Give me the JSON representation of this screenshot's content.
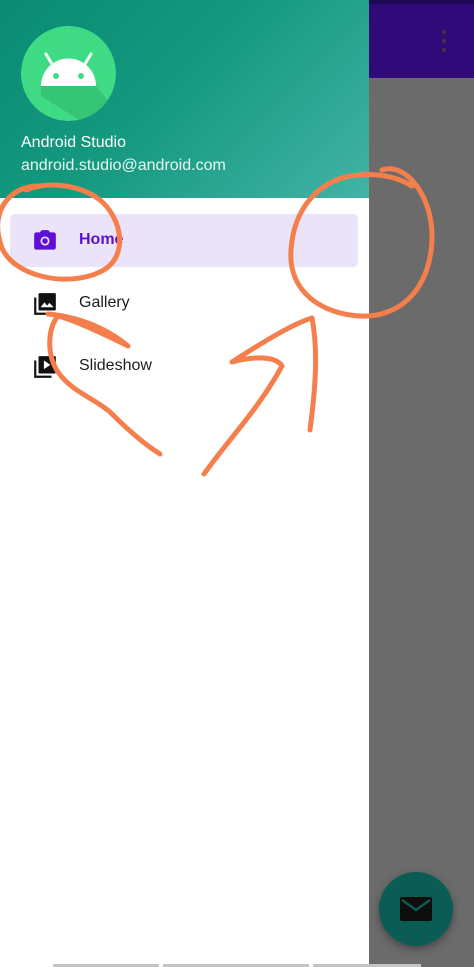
{
  "drawer": {
    "header": {
      "name": "Android Studio",
      "email": "android.studio@android.com"
    },
    "items": [
      {
        "label": "Home",
        "icon": "camera-icon",
        "active": true
      },
      {
        "label": "Gallery",
        "icon": "gallery-icon",
        "active": false
      },
      {
        "label": "Slideshow",
        "icon": "slideshow-icon",
        "active": false
      }
    ]
  },
  "colors": {
    "toolbar": "#2f0a78",
    "header_start": "#0a8a74",
    "header_end": "#43b3a6",
    "active_bg": "#ebe3f9",
    "active_text": "#5e0fd6",
    "scrim": "#6b6b6b",
    "fab": "#0b5c55",
    "annotation": "#f47f4c"
  },
  "fab": {
    "icon": "mail-icon"
  },
  "toolbar": {
    "icon": "more-vert-icon"
  }
}
